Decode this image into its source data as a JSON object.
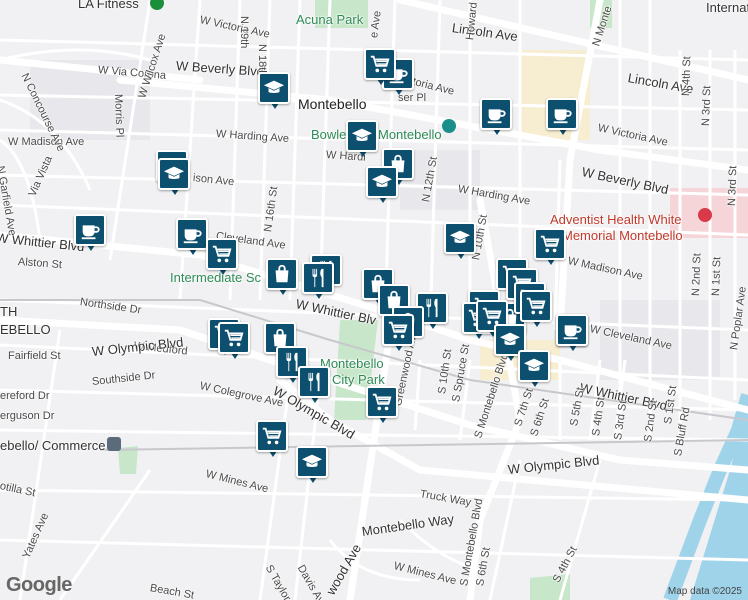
{
  "attribution": {
    "logo": "Google",
    "copyright": "Map data ©2025"
  },
  "colors": {
    "pin": "#0d4f6e",
    "park": "#c8e6c9",
    "water": "#9fd3ea",
    "hospital": "#f6d5d9",
    "commercial": "#f7edd0"
  },
  "labels": {
    "acuna_park": "Acuna Park",
    "montebello": "Montebello",
    "bowle": "Bowle",
    "montebello2": "Montebello",
    "lincoln_ave": "Lincoln Ave",
    "lincoln_ave2": "Lincoln Ave",
    "w_victoria_ave": "W Victoria Ave",
    "victoria_ave": "Victoria Ave",
    "w_victoria_ave2": "W Victoria Ave",
    "w_via_corona": "W Via Corona",
    "w_beverly_blvd": "W Beverly Blvd",
    "w_beverly_blvd2": "W Beverly Blvd",
    "w_harding_ave": "W Harding Ave",
    "w_harding": "W Hardi",
    "w_harding_ave2": "W Harding Ave",
    "w_madison_ave": "W Madison Ave",
    "madison_ave": "ison Ave",
    "w_madison_ave2": "W Madison Ave",
    "cleveland": "Cleveland Ave",
    "w_cleveland_ave": "W Cleveland Ave",
    "w_whittier_blvd": "W Whittier Blvd",
    "w_whittier_blvd2": "W Whittier Blvd",
    "w_whittier_blvd3": "W Whittier Blvd",
    "w_whittier_partial": "W Whittier Blv",
    "alston_st": "Alston St",
    "northside_dr": "Northside Dr",
    "ebello": "EBELLO",
    "th": "TH",
    "w_medford": "W Medford",
    "w_olympic_blvd": "W Olympic Blvd",
    "w_olympic_blvd2": "W Olympic Blvd",
    "w_olympic_blvd3": "W Olympic Blvd",
    "fairfield_st": "Fairfield St",
    "southside_dr": "Southside Dr",
    "ereford_dr": "ereford Dr",
    "erguson_dr": "erguson Dr",
    "w_colegrove_ave": "W Colegrove Ave",
    "montebello_commerce": "ebello/ Commerce",
    "otilla_st": "otilla St",
    "w_mines_ave": "W Mines Ave",
    "w_mines_ave2": "W Mines Ave",
    "yates_ave": "Yates Ave",
    "truck_way": "Truck Way",
    "montebello_way": "Montebello Way",
    "beach_st": "Beach St",
    "s_taylor_ave": "S Taylor Ave",
    "s_davis_ave": "Davis Ave",
    "wood_ave": "wood Ave",
    "montebello_city_park": "Montebello",
    "city_park": "City Park",
    "intermediate_school": "Intermediate Sc",
    "adventist": "Adventist Health White",
    "memorial": "Memorial Montebello",
    "n_concourse_ave": "N Concourse Ave",
    "w_wilcox_ave": "W Wilcox Ave",
    "morris_pl": "Morris Pl",
    "n_garfield_ave": "N Garfield Ave",
    "via_vista": "Via Vista",
    "n_19th_st": "N 19th",
    "n_18th_st": "N 18th St",
    "n_16th_st": "N 16th St",
    "howard_ave": "Howard Ave",
    "n_12th_st": "N 12th St",
    "n_10th_st": "N 10th St",
    "s_10th_st": "S 10th St",
    "s_spruce_st": "S Spruce St",
    "greenwood_ave": "Greenwood Ave",
    "s_montebello_blvd": "S Montebello Blvd",
    "s_montebello_blvd2": "S Montebello Blvd",
    "s_6th_st": "S 6th St",
    "s_6th_st2": "S 6th St",
    "s_7th_st": "S 7th St",
    "s_5th_st": "S 5th St",
    "s_4th_st": "S 4th St",
    "s_4th_st2": "S 4th St",
    "s_3rd_st": "S 3rd St",
    "s_2nd_st": "S 2nd St",
    "s_1st_st": "S 1st St",
    "s_bluff_rd": "S Bluff Rd",
    "n_4th_st": "N 4th St",
    "n_3rd_st": "N 3rd St",
    "n_3rd_st2": "N 3rd St",
    "n_2nd_st": "N 2nd St",
    "n_1st_st": "N 1st St",
    "n_poplar_ave": "N Poplar Ave",
    "n_montebello": "N Monte",
    "ave_partial": "ave",
    "e_ave": "e Ave",
    "ser_pl": "ser Pl",
    "w_vi": "Wh",
    "internat": "Internat",
    "la_fitness": "LA Fitness",
    "ave_avd": "Ave"
  },
  "pins": [
    {
      "type": "cafe"
    },
    {
      "type": "education"
    },
    {
      "type": "grocery"
    },
    {
      "type": "cafe"
    },
    {
      "type": "education"
    },
    {
      "type": "shopping"
    },
    {
      "type": "education"
    },
    {
      "type": "education"
    },
    {
      "type": "education"
    },
    {
      "type": "cafe"
    },
    {
      "type": "cafe"
    },
    {
      "type": "cafe"
    },
    {
      "type": "cafe"
    },
    {
      "type": "grocery"
    },
    {
      "type": "education"
    },
    {
      "type": "grocery"
    },
    {
      "type": "shopping"
    },
    {
      "type": "restaurant"
    },
    {
      "type": "restaurant"
    },
    {
      "type": "shopping"
    },
    {
      "type": "shopping"
    },
    {
      "type": "restaurant"
    },
    {
      "type": "grocery"
    },
    {
      "type": "shopping"
    },
    {
      "type": "grocery"
    },
    {
      "type": "grocery"
    },
    {
      "type": "grocery"
    },
    {
      "type": "grocery"
    },
    {
      "type": "grocery"
    },
    {
      "type": "grocery"
    },
    {
      "type": "shopping"
    },
    {
      "type": "education"
    },
    {
      "type": "cafe"
    },
    {
      "type": "grocery"
    },
    {
      "type": "grocery"
    },
    {
      "type": "shopping"
    },
    {
      "type": "restaurant"
    },
    {
      "type": "restaurant"
    },
    {
      "type": "grocery"
    },
    {
      "type": "grocery"
    },
    {
      "type": "education"
    },
    {
      "type": "education"
    },
    {
      "type": "grocery"
    }
  ]
}
